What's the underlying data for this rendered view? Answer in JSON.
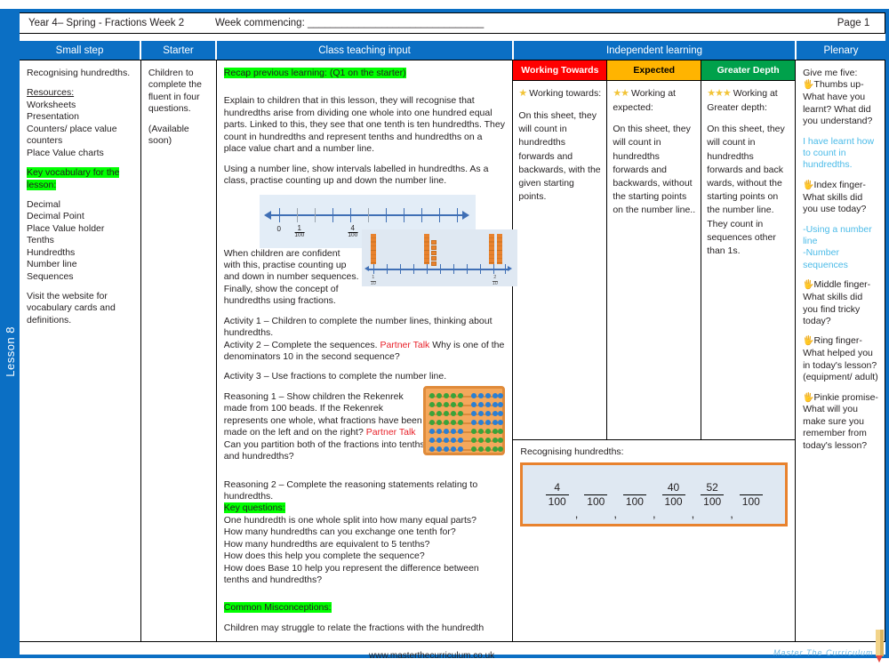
{
  "header": {
    "year_term": "Year 4– Spring - Fractions Week 2",
    "week_commencing": "Week commencing: _______________________________",
    "page": "Page 1"
  },
  "lesson_tab": "Lesson 8",
  "columns": [
    {
      "key": "small_step",
      "label": "Small step"
    },
    {
      "key": "starter",
      "label": "Starter"
    },
    {
      "key": "class_teaching_input",
      "label": "Class teaching input"
    },
    {
      "key": "independent_learning",
      "label": "Independent learning"
    },
    {
      "key": "plenary",
      "label": "Plenary"
    }
  ],
  "small_step": {
    "title": "Recognising hundredths.",
    "resources_label": "Resources:",
    "resources": [
      "Worksheets",
      "Presentation",
      "Counters/ place value counters",
      "Place Value charts"
    ],
    "key_vocab_label": "Key vocabulary for the lesson:",
    "vocab": [
      "Decimal",
      "Decimal Point",
      "Place Value holder",
      "Tenths",
      "Hundredths",
      "Number line",
      "Sequences"
    ],
    "footnote": "Visit the website for vocabulary cards and definitions."
  },
  "starter": {
    "line1": "Children to complete the fluent in four questions.",
    "line2": "(Available soon)"
  },
  "teaching": {
    "recap_heading": "Recap previous learning: (Q1 on the starter)",
    "para1": "Explain to children that in this lesson, they will recognise that hundredths arise from dividing one whole into one hundred equal parts. Linked to this, they see that one tenth is ten hundredths. They count in hundredths and represent tenths and hundredths on a place value chart and a number line.",
    "para2": "Using a number line, show intervals labelled in hundredths. As a class, practise counting up and down the number line.",
    "numberline1": {
      "labels": [
        {
          "pos": 0,
          "whole": "0"
        },
        {
          "pos": 1,
          "num": "1",
          "den": "100"
        },
        {
          "pos": 4,
          "num": "4",
          "den": "100"
        }
      ],
      "ticks": 11
    },
    "para3": "When children are confident with this, practise counting up and down in number sequences. Finally, show the concept of hundredths using fractions.",
    "numberline2": {
      "left_label_num": "1",
      "left_label_den": "10",
      "right_label_num": "2",
      "right_label_den": "10",
      "ticks": 11
    },
    "activity1": "Activity 1 – Children to complete the number lines, thinking about hundredths.",
    "activity2_a": "Activity 2 – Complete the sequences. ",
    "activity2_talk": "Partner Talk",
    "activity2_b": " Why is one of the denominators 10 in the second sequence?",
    "activity3": "Activity 3 – Use fractions to complete the number line.",
    "reasoning1_a": "Reasoning 1 – Show children the Rekenrek made from 100 beads. If the Rekenrek represents one whole, what fractions have been made on the left and on the right? ",
    "reasoning1_talk": "Partner Talk",
    "reasoning1_b": " Can you partition both of the fractions into tenths and hundredths?",
    "reasoning2": "Reasoning 2 – Complete the reasoning statements relating to hundredths.",
    "key_questions_label": "Key questions:",
    "key_questions": [
      "One hundredth is one whole split into how many equal parts?",
      "How many hundredths can you exchange one tenth for?",
      "How many hundredths are equivalent to 5 tenths?",
      "How does this help you complete the sequence?",
      "How does Base 10 help you represent the difference between tenths and hundredths?"
    ],
    "misconceptions_label": "Common Misconceptions:",
    "misconceptions_text": "Children may struggle to relate the fractions with the hundredth"
  },
  "independent": {
    "levels": [
      {
        "label": "Working Towards",
        "color": "#ff0000",
        "stars": "★",
        "intro": "Working towards:",
        "body": "On this sheet, they will count in hundredths forwards and backwards, with the given starting points."
      },
      {
        "label": "Expected",
        "color": "#ffb400",
        "stars": "★★",
        "intro": "Working at expected:",
        "body": "On this sheet, they will count in hundredths forwards and backwards, without the starting points on the number line.."
      },
      {
        "label": "Greater Depth",
        "color": "#00a14b",
        "stars": "★★★",
        "intro": "Working at Greater depth:",
        "body": "On this sheet, they will count in hundredths forwards and back wards, without the starting points on the number line. They count in sequences other than 1s."
      }
    ],
    "recognising_label": "Recognising hundredths:",
    "fraction_sequence": [
      {
        "num": "4",
        "den": "100"
      },
      {
        "num": "",
        "den": "100"
      },
      {
        "num": "",
        "den": "100"
      },
      {
        "num": "40",
        "den": "100"
      },
      {
        "num": "52",
        "den": "100"
      },
      {
        "num": "",
        "den": "100"
      }
    ],
    "separator": ","
  },
  "plenary": {
    "intro": "Give me five:",
    "items": [
      {
        "hand": "🖐",
        "text": "Thumbs up- What have you learnt? What did you understand?"
      },
      {
        "hand": "",
        "text": "I have learnt how to count in hundredths.",
        "accent": true
      },
      {
        "hand": "🖐",
        "text": "Index finger- What skills did you use today?"
      },
      {
        "hand": "",
        "text": "-Using a number line\n-Number sequences",
        "accent": true
      },
      {
        "hand": "🖐",
        "text": "Middle finger- What skills did you find tricky today?"
      },
      {
        "hand": "🖐",
        "text": "Ring finger- What helped you in today's lesson? (equipment/ adult)"
      },
      {
        "hand": "🖐",
        "text": "Pinkie promise- What will you make sure you remember from today's lesson?"
      }
    ]
  },
  "footer": {
    "url": "www.masterthecurriculum.co.uk",
    "logo": "Master The Curriculum"
  }
}
